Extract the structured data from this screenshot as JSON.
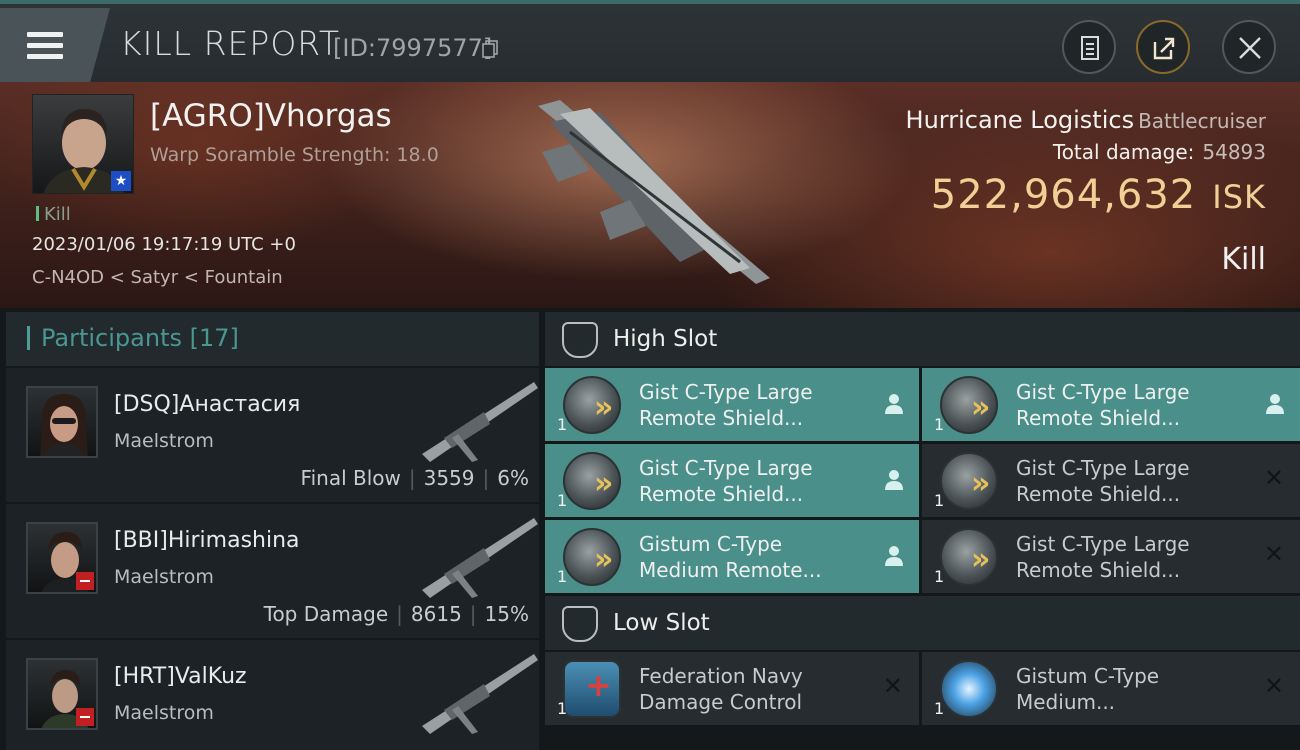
{
  "header": {
    "title": "KILL REPORT",
    "report_id": "[ID:7997577]"
  },
  "victim": {
    "name": "[AGRO]Vhorgas",
    "attribute": "Warp Soramble Strength: 18.0",
    "tag": "Kill",
    "datetime": "2023/01/06 19:17:19 UTC +0",
    "location": "C-N4OD < Satyr < Fountain",
    "ship_name": "Hurricane Logistics",
    "ship_class": "Battlecruiser",
    "damage_label": "Total damage:",
    "damage_value": "54893",
    "isk_value": "522,964,632",
    "isk_unit": "ISK",
    "result": "Kill"
  },
  "participants": {
    "label": "Participants",
    "count": "[17]",
    "items": [
      {
        "name": "[DSQ]Анастасия",
        "ship": "Maelstrom",
        "role": "Final Blow",
        "damage": "3559",
        "percent": "6%"
      },
      {
        "name": "[BBI]Hirimashina",
        "ship": "Maelstrom",
        "role": "Top Damage",
        "damage": "8615",
        "percent": "15%"
      },
      {
        "name": "[HRT]ValKuz",
        "ship": "Maelstrom"
      }
    ]
  },
  "high_slot": {
    "label": "High Slot",
    "modules": [
      {
        "line1": "Gist C-Type Large",
        "line2": "Remote Shield...",
        "qty": "1",
        "state": "dropped"
      },
      {
        "line1": "Gist C-Type Large",
        "line2": "Remote Shield...",
        "qty": "1",
        "state": "dropped"
      },
      {
        "line1": "Gist C-Type Large",
        "line2": "Remote Shield...",
        "qty": "1",
        "state": "dropped"
      },
      {
        "line1": "Gist C-Type Large",
        "line2": "Remote Shield...",
        "qty": "1",
        "state": "destroyed"
      },
      {
        "line1": "Gistum C-Type",
        "line2": "Medium Remote...",
        "qty": "1",
        "state": "dropped"
      },
      {
        "line1": "Gist C-Type Large",
        "line2": "Remote Shield...",
        "qty": "1",
        "state": "destroyed"
      }
    ]
  },
  "low_slot": {
    "label": "Low Slot",
    "modules": [
      {
        "line1": "Federation Navy",
        "line2": "Damage Control",
        "qty": "1",
        "state": "destroyed"
      },
      {
        "line1": "Gistum C-Type",
        "line2": "Medium...",
        "qty": "1",
        "state": "destroyed"
      }
    ]
  },
  "colors": {
    "accent": "#4b8f8a",
    "isk": "#f0d095",
    "danger": "#c21f22"
  },
  "icons": [
    "menu-icon",
    "copy-icon",
    "clipboard-icon",
    "share-icon",
    "close-icon",
    "slot-icon",
    "pilot-icon",
    "x-icon"
  ]
}
